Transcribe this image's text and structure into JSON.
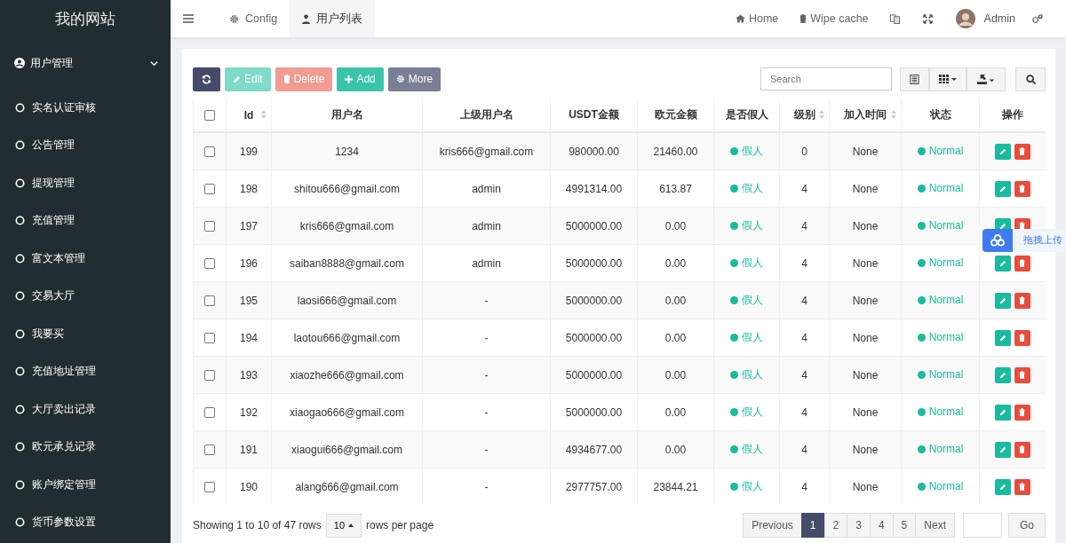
{
  "sidebar": {
    "logo": "我的网站",
    "menu": {
      "label": "用户管理",
      "expanded": true
    },
    "items": [
      {
        "label": "实名认证审核"
      },
      {
        "label": "公告管理"
      },
      {
        "label": "提现管理"
      },
      {
        "label": "充值管理"
      },
      {
        "label": "富文本管理"
      },
      {
        "label": "交易大厅"
      },
      {
        "label": "我要买"
      },
      {
        "label": "充值地址管理"
      },
      {
        "label": "大厅卖出记录"
      },
      {
        "label": "欧元承兑记录"
      },
      {
        "label": "账户绑定管理"
      },
      {
        "label": "货币参数设置"
      }
    ]
  },
  "header": {
    "tabs": [
      {
        "label": "Config",
        "kind": "gear",
        "selected": false
      },
      {
        "label": "用户列表",
        "kind": "user",
        "selected": true
      }
    ],
    "links": [
      {
        "label": "Home",
        "kind": "home"
      },
      {
        "label": "Wipe cache",
        "kind": "trash"
      }
    ],
    "user": "Admin"
  },
  "toolbar": {
    "buttons": [
      {
        "label": "Edit",
        "kind": "edit",
        "disabled": true
      },
      {
        "label": "Delete",
        "kind": "delete",
        "disabled": true
      },
      {
        "label": "Add",
        "kind": "add",
        "disabled": false
      },
      {
        "label": "More",
        "kind": "more",
        "disabled": false
      }
    ],
    "search": {
      "placeholder": "Search"
    }
  },
  "table": {
    "select_all": {
      "checked": false
    },
    "columns": [
      {
        "label": "Id",
        "sortable": true
      },
      {
        "label": "用户名",
        "sortable": false
      },
      {
        "label": "上级用户名",
        "sortable": false
      },
      {
        "label": "USDT金额",
        "sortable": false
      },
      {
        "label": "欧元金额",
        "sortable": false
      },
      {
        "label": "是否假人",
        "sortable": false
      },
      {
        "label": "级别",
        "sortable": true
      },
      {
        "label": "加入时间",
        "sortable": true
      },
      {
        "label": "状态",
        "sortable": false
      },
      {
        "label": "操作",
        "sortable": false
      }
    ],
    "rows": [
      {
        "checked": false,
        "id": "199",
        "username": "1234",
        "parent": "kris666@gmail.com",
        "usdt": "980000.00",
        "eur": "21460.00",
        "fake": "假人",
        "level": "0",
        "joined": "None",
        "status": "Normal"
      },
      {
        "checked": false,
        "id": "198",
        "username": "shitou666@gmail.com",
        "parent": "admin",
        "usdt": "4991314.00",
        "eur": "613.87",
        "fake": "假人",
        "level": "4",
        "joined": "None",
        "status": "Normal"
      },
      {
        "checked": false,
        "id": "197",
        "username": "kris666@gmail.com",
        "parent": "admin",
        "usdt": "5000000.00",
        "eur": "0.00",
        "fake": "假人",
        "level": "4",
        "joined": "None",
        "status": "Normal"
      },
      {
        "checked": false,
        "id": "196",
        "username": "saiban8888@gmail.com",
        "parent": "admin",
        "usdt": "5000000.00",
        "eur": "0.00",
        "fake": "假人",
        "level": "4",
        "joined": "None",
        "status": "Normal"
      },
      {
        "checked": false,
        "id": "195",
        "username": "laosi666@gmail.com",
        "parent": "-",
        "usdt": "5000000.00",
        "eur": "0.00",
        "fake": "假人",
        "level": "4",
        "joined": "None",
        "status": "Normal"
      },
      {
        "checked": false,
        "id": "194",
        "username": "laotou666@gmail.com",
        "parent": "-",
        "usdt": "5000000.00",
        "eur": "0.00",
        "fake": "假人",
        "level": "4",
        "joined": "None",
        "status": "Normal"
      },
      {
        "checked": false,
        "id": "193",
        "username": "xiaozhe666@gmail.com",
        "parent": "-",
        "usdt": "5000000.00",
        "eur": "0.00",
        "fake": "假人",
        "level": "4",
        "joined": "None",
        "status": "Normal"
      },
      {
        "checked": false,
        "id": "192",
        "username": "xiaogao666@gmail.com",
        "parent": "-",
        "usdt": "5000000.00",
        "eur": "0.00",
        "fake": "假人",
        "level": "4",
        "joined": "None",
        "status": "Normal"
      },
      {
        "checked": false,
        "id": "191",
        "username": "xiaogui666@gmail.com",
        "parent": "-",
        "usdt": "4934677.00",
        "eur": "0.00",
        "fake": "假人",
        "level": "4",
        "joined": "None",
        "status": "Normal"
      },
      {
        "checked": false,
        "id": "190",
        "username": "alang666@gmail.com",
        "parent": "-",
        "usdt": "2977757.00",
        "eur": "23844.21",
        "fake": "假人",
        "level": "4",
        "joined": "None",
        "status": "Normal"
      }
    ]
  },
  "footer": {
    "showing": "Showing 1 to 10 of 47 rows",
    "page_size": "10",
    "rows_per_page": "rows per page",
    "pages": [
      {
        "label": "1",
        "selected": true
      },
      {
        "label": "2",
        "selected": false
      },
      {
        "label": "3",
        "selected": false
      },
      {
        "label": "4",
        "selected": false
      },
      {
        "label": "5",
        "selected": false
      }
    ],
    "previous": "Previous",
    "next": "Next",
    "go": "Go"
  },
  "upload_widget": {
    "label": "拖拽上传"
  }
}
